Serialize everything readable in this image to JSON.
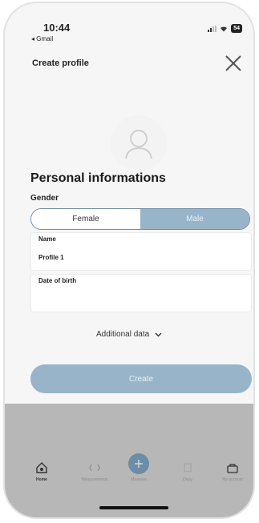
{
  "status_bar": {
    "time": "10:44",
    "back_app": "◂ Gmail",
    "battery": "54"
  },
  "header": {
    "title": "Create profile",
    "close_icon": "close-icon"
  },
  "avatar": {
    "icon": "user-icon"
  },
  "section": {
    "title": "Personal informations",
    "gender_label": "Gender",
    "gender_options": [
      "Female",
      "Male"
    ],
    "gender_selected": "Male"
  },
  "fields": {
    "name_label": "Name",
    "name_value": "Profile 1",
    "dob_label": "Date of birth",
    "dob_value": ""
  },
  "additional_data": "Additional data",
  "create_label": "Create",
  "colors": {
    "accent": "#98b4c9",
    "border": "#6f8fa6",
    "overlay": "#b7b7b7",
    "fab": "#6d8ca6"
  },
  "tabs": [
    {
      "label": "Home",
      "icon": "home-icon",
      "active": true
    },
    {
      "label": "Measurements",
      "icon": "measure-icon",
      "active": false
    },
    {
      "label": "Measure",
      "icon": "plus-icon",
      "active": false
    },
    {
      "label": "Diary",
      "icon": "diary-icon",
      "active": false
    },
    {
      "label": "My account",
      "icon": "account-icon",
      "active": false
    }
  ]
}
